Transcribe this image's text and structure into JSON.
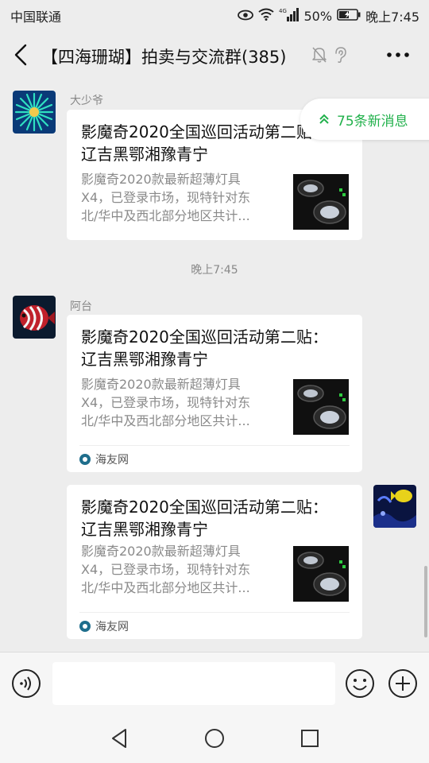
{
  "status_bar": {
    "carrier": "中国联通",
    "battery": "50%",
    "time": "晚上7:45",
    "network": "4G"
  },
  "header": {
    "title": "【四海珊瑚】拍卖与交流群(385)"
  },
  "new_messages": {
    "label": "75条新消息"
  },
  "messages": [
    {
      "sender": "大少爷",
      "card_title": "影魔奇2020全国巡回活动第二贴： 辽吉黑鄂湘豫青宁",
      "card_desc": [
        "影魔奇2020款最新超薄灯具",
        "X4，已登录市场，现特针对东",
        "北/华中及西北部分地区共计..."
      ],
      "source": ""
    },
    {
      "sender": "阿台",
      "card_title": "影魔奇2020全国巡回活动第二贴： 辽吉黑鄂湘豫青宁",
      "card_desc": [
        "影魔奇2020款最新超薄灯具",
        "X4，已登录市场，现特针对东",
        "北/华中及西北部分地区共计..."
      ],
      "source": "海友网"
    },
    {
      "sender": "",
      "card_title": "影魔奇2020全国巡回活动第二贴： 辽吉黑鄂湘豫青宁",
      "card_desc": [
        "影魔奇2020款最新超薄灯具",
        "X4，已登录市场，现特针对东",
        "北/华中及西北部分地区共计..."
      ],
      "source": "海友网"
    }
  ],
  "timestamp": "晚上7:45",
  "input": {
    "value": ""
  },
  "colors": {
    "accent_green": "#22b14c",
    "background": "#ededed",
    "card": "#ffffff"
  }
}
